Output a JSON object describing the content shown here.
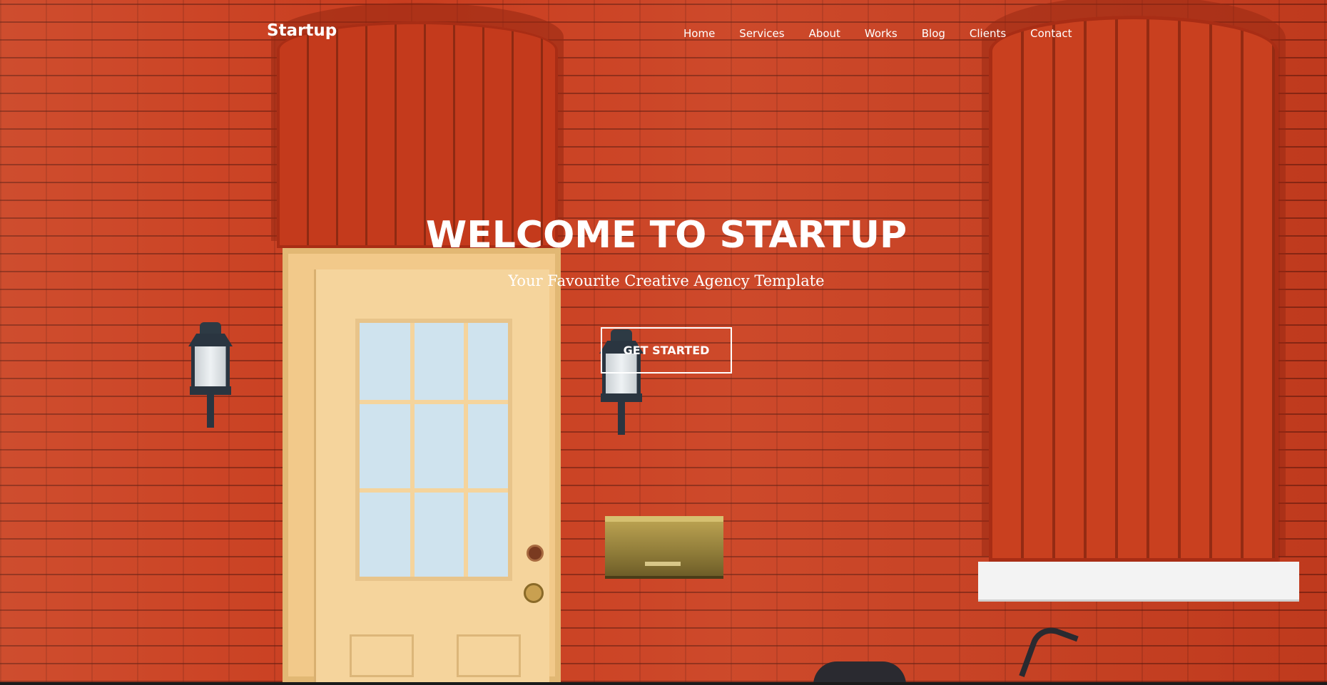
{
  "nav": {
    "brand": "Startup",
    "items": [
      {
        "label": "Home"
      },
      {
        "label": "Services"
      },
      {
        "label": "About"
      },
      {
        "label": "Works"
      },
      {
        "label": "Blog"
      },
      {
        "label": "Clients"
      },
      {
        "label": "Contact"
      }
    ]
  },
  "hero": {
    "title": "WELCOME TO STARTUP",
    "subtitle": "Your Favourite Creative Agency Template",
    "cta_label": "GET STARTED"
  },
  "colors": {
    "brick": "#c93d1f",
    "text": "#ffffff",
    "door": "#f5d49c",
    "sill": "#f3f3f3"
  }
}
